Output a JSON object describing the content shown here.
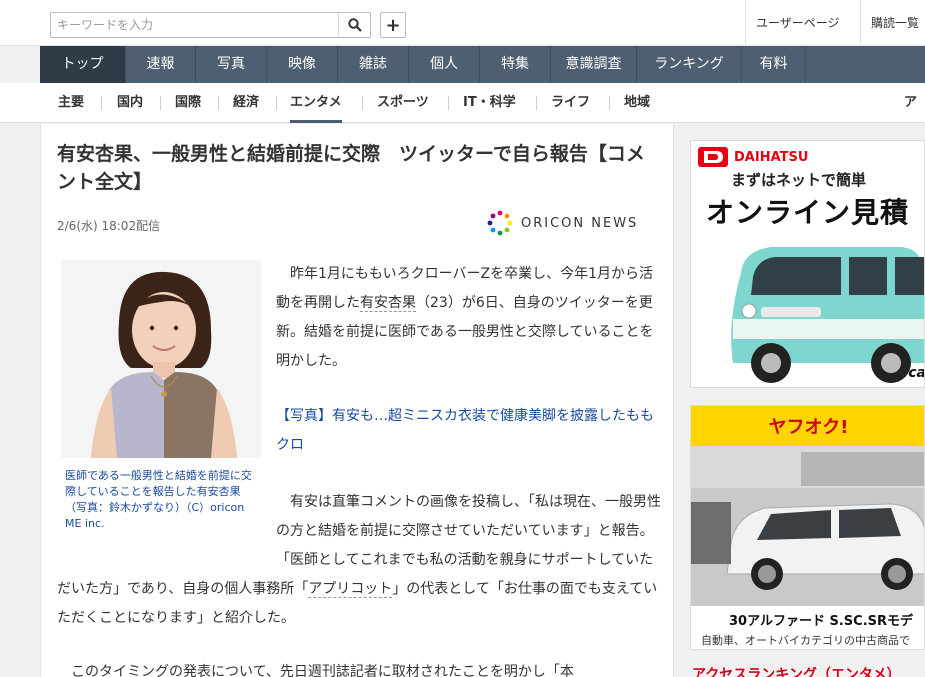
{
  "search": {
    "placeholder": "キーワードを入力"
  },
  "utility": {
    "user_page": "ユーザーページ",
    "subscriptions": "購読一覧"
  },
  "main_nav": [
    "トップ",
    "速報",
    "写真",
    "映像",
    "雑誌",
    "個人",
    "特集",
    "意識調査",
    "ランキング",
    "有料"
  ],
  "sub_nav": [
    "主要",
    "国内",
    "国際",
    "経済",
    "エンタメ",
    "スポーツ",
    "IT・科学",
    "ライフ",
    "地域",
    "ア"
  ],
  "article": {
    "title": "有安杏果、一般男性と結婚前提に交際　ツイッターで自ら報告【コメント全文】",
    "date": "2/6(水) 18:02配信",
    "provider": "ORICON NEWS",
    "caption": "医師である一般男性と結婚を前提に交際していることを報告した有安杏果（写真：鈴木かずなり）（C）oricon ME inc.",
    "p1_a": "　昨年1月にももいろクローバーZを卒業し、今年1月から活動を再開した",
    "p1_kw": "有安杏果",
    "p1_b": "（23）が6日、自身のツイッターを更新。結婚を前提に医師である一般男性と交際していることを明かした。",
    "related": "【写真】有安も…超ミニスカ衣装で健康美脚を披露したももクロ",
    "p2_a": "　有安は直筆コメントの画像を投稿し、「私は現在、一般男性の方と結婚を前提に交際させていただいています」と報告。「医師としてこれまでも私の活動を親身にサポートしていただいた方」であり、自身の個人事務所「",
    "p2_kw": "アプリコット",
    "p2_b": "」の代表として「お仕事の面でも支えていただくことになります」と紹介した。",
    "p3": "　このタイミングの発表について、先日週刊誌記者に取材されたことを明かし「本"
  },
  "ads": {
    "ad1": {
      "brand": "DAIHATSU",
      "line1": "まずはネットで簡単",
      "line2": "オンライン見積",
      "corner": "ca"
    },
    "ad2": {
      "brand": "ヤフオク!",
      "title": "30アルファード S.SC.SRモデ",
      "sub": "自動車、オートバイカテゴリの中古商品で",
      "footer": "アクセスランキング（エンタメ）"
    }
  },
  "colors": {
    "nav_bg": "#4e5f71",
    "nav_active": "#2f3b47",
    "link": "#1a4aa0",
    "daihatsu_red": "#e60012",
    "yafuoku_yellow": "#ffd400"
  }
}
